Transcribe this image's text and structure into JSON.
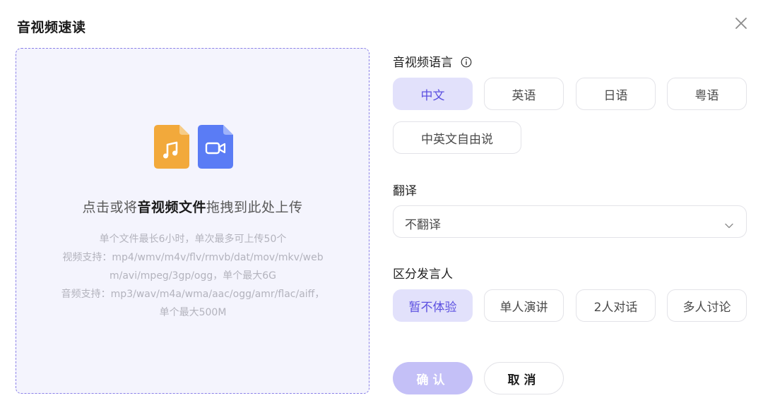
{
  "dialog": {
    "title": "音视频速读"
  },
  "upload": {
    "headline_prefix": "点击或将",
    "headline_bold": "音视频文件",
    "headline_suffix": "拖拽到此处上传",
    "notes": [
      "单个文件最长6小时，单次最多可上传50个",
      "视频支持：mp4/wmv/m4v/flv/rmvb/dat/mov/mkv/webm/avi/mpeg/3gp/ogg，单个最大6G",
      "音频支持：mp3/wav/m4a/wma/aac/ogg/amr/flac/aiff，单个最大500M"
    ],
    "icons": [
      "audio-file-icon",
      "video-file-icon"
    ]
  },
  "language": {
    "label": "音视频语言",
    "info_icon": "ⓘ",
    "options": [
      "中文",
      "英语",
      "日语",
      "粤语",
      "中英文自由说"
    ],
    "selected": "中文"
  },
  "translation": {
    "label": "翻译",
    "selected": "不翻译"
  },
  "speaker": {
    "label": "区分发言人",
    "options": [
      "暂不体验",
      "单人演讲",
      "2人对话",
      "多人讨论"
    ],
    "selected": "暂不体验"
  },
  "actions": {
    "confirm": "确认",
    "cancel": "取消"
  },
  "colors": {
    "accent": "#5b4fe0",
    "accent_light": "#e2e1fb",
    "confirm_disabled": "#c4c0f7",
    "audio_icon": "#f2a93b",
    "video_icon": "#5a7cf5"
  }
}
